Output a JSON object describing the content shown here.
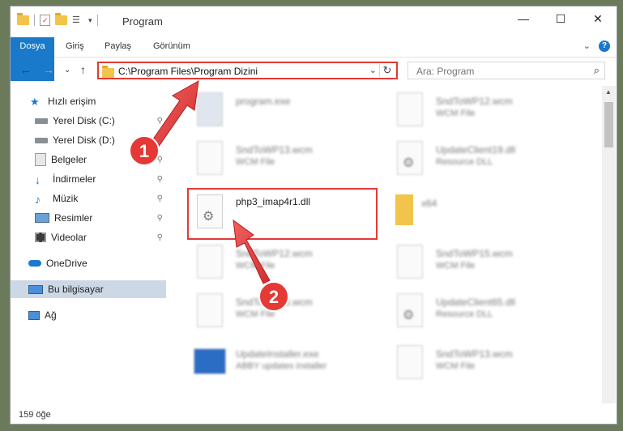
{
  "window": {
    "title": "Program",
    "controls": {
      "minimize": "—",
      "maximize": "☐",
      "close": "✕"
    }
  },
  "ribbon": {
    "tabs": [
      "Dosya",
      "Giriş",
      "Paylaş",
      "Görünüm"
    ],
    "expand": "⌄",
    "help": "?"
  },
  "address": {
    "path": "C:\\Program Files\\Program Dizini",
    "dropdown": "⌄",
    "refresh": "↻"
  },
  "search": {
    "placeholder": "Ara: Program"
  },
  "nav": {
    "back": "←",
    "forward": "→",
    "recent": "⌄",
    "up": "↑"
  },
  "sidebar": {
    "items": [
      {
        "label": "Hızlı erişim",
        "icon": "star-icon"
      },
      {
        "label": "Yerel Disk (C:)",
        "icon": "drive-icon"
      },
      {
        "label": "Yerel Disk (D:)",
        "icon": "drive-icon"
      },
      {
        "label": "Belgeler",
        "icon": "documents-icon"
      },
      {
        "label": "İndirmeler",
        "icon": "download-icon"
      },
      {
        "label": "Müzik",
        "icon": "music-icon"
      },
      {
        "label": "Resimler",
        "icon": "pictures-icon"
      },
      {
        "label": "Videolar",
        "icon": "videos-icon"
      },
      {
        "label": "OneDrive",
        "icon": "cloud-icon"
      },
      {
        "label": "Bu bilgisayar",
        "icon": "computer-icon"
      },
      {
        "label": "Ağ",
        "icon": "network-icon"
      }
    ],
    "pin": "📌"
  },
  "files": [
    {
      "name": "program.exe",
      "sub": ""
    },
    {
      "name": "SndToWP12.wcm",
      "sub": "WCM File"
    },
    {
      "name": "SndToWP13.wcm",
      "sub": "WCM File"
    },
    {
      "name": "UpdateClient19.dll",
      "sub": "Resource DLL"
    },
    {
      "name": "php3_imap4r1.dll",
      "sub": ""
    },
    {
      "name": "x64",
      "sub": ""
    },
    {
      "name": "SndToWP12.wcm",
      "sub": "WCM File"
    },
    {
      "name": "SndToWP15.wcm",
      "sub": "WCM File"
    },
    {
      "name": "SndToWP13.wcm",
      "sub": "WCM File"
    },
    {
      "name": "UpdateClient65.dll",
      "sub": "Resource DLL"
    },
    {
      "name": "UpdateInstaller.exe",
      "sub": "ABBY updates installer"
    },
    {
      "name": "SndToWP13.wcm",
      "sub": "WCM File"
    }
  ],
  "status": {
    "count": "159 öğe"
  },
  "annotations": {
    "step1": "1",
    "step2": "2"
  },
  "colors": {
    "accent": "#1979ca",
    "annotation": "#e53935"
  }
}
